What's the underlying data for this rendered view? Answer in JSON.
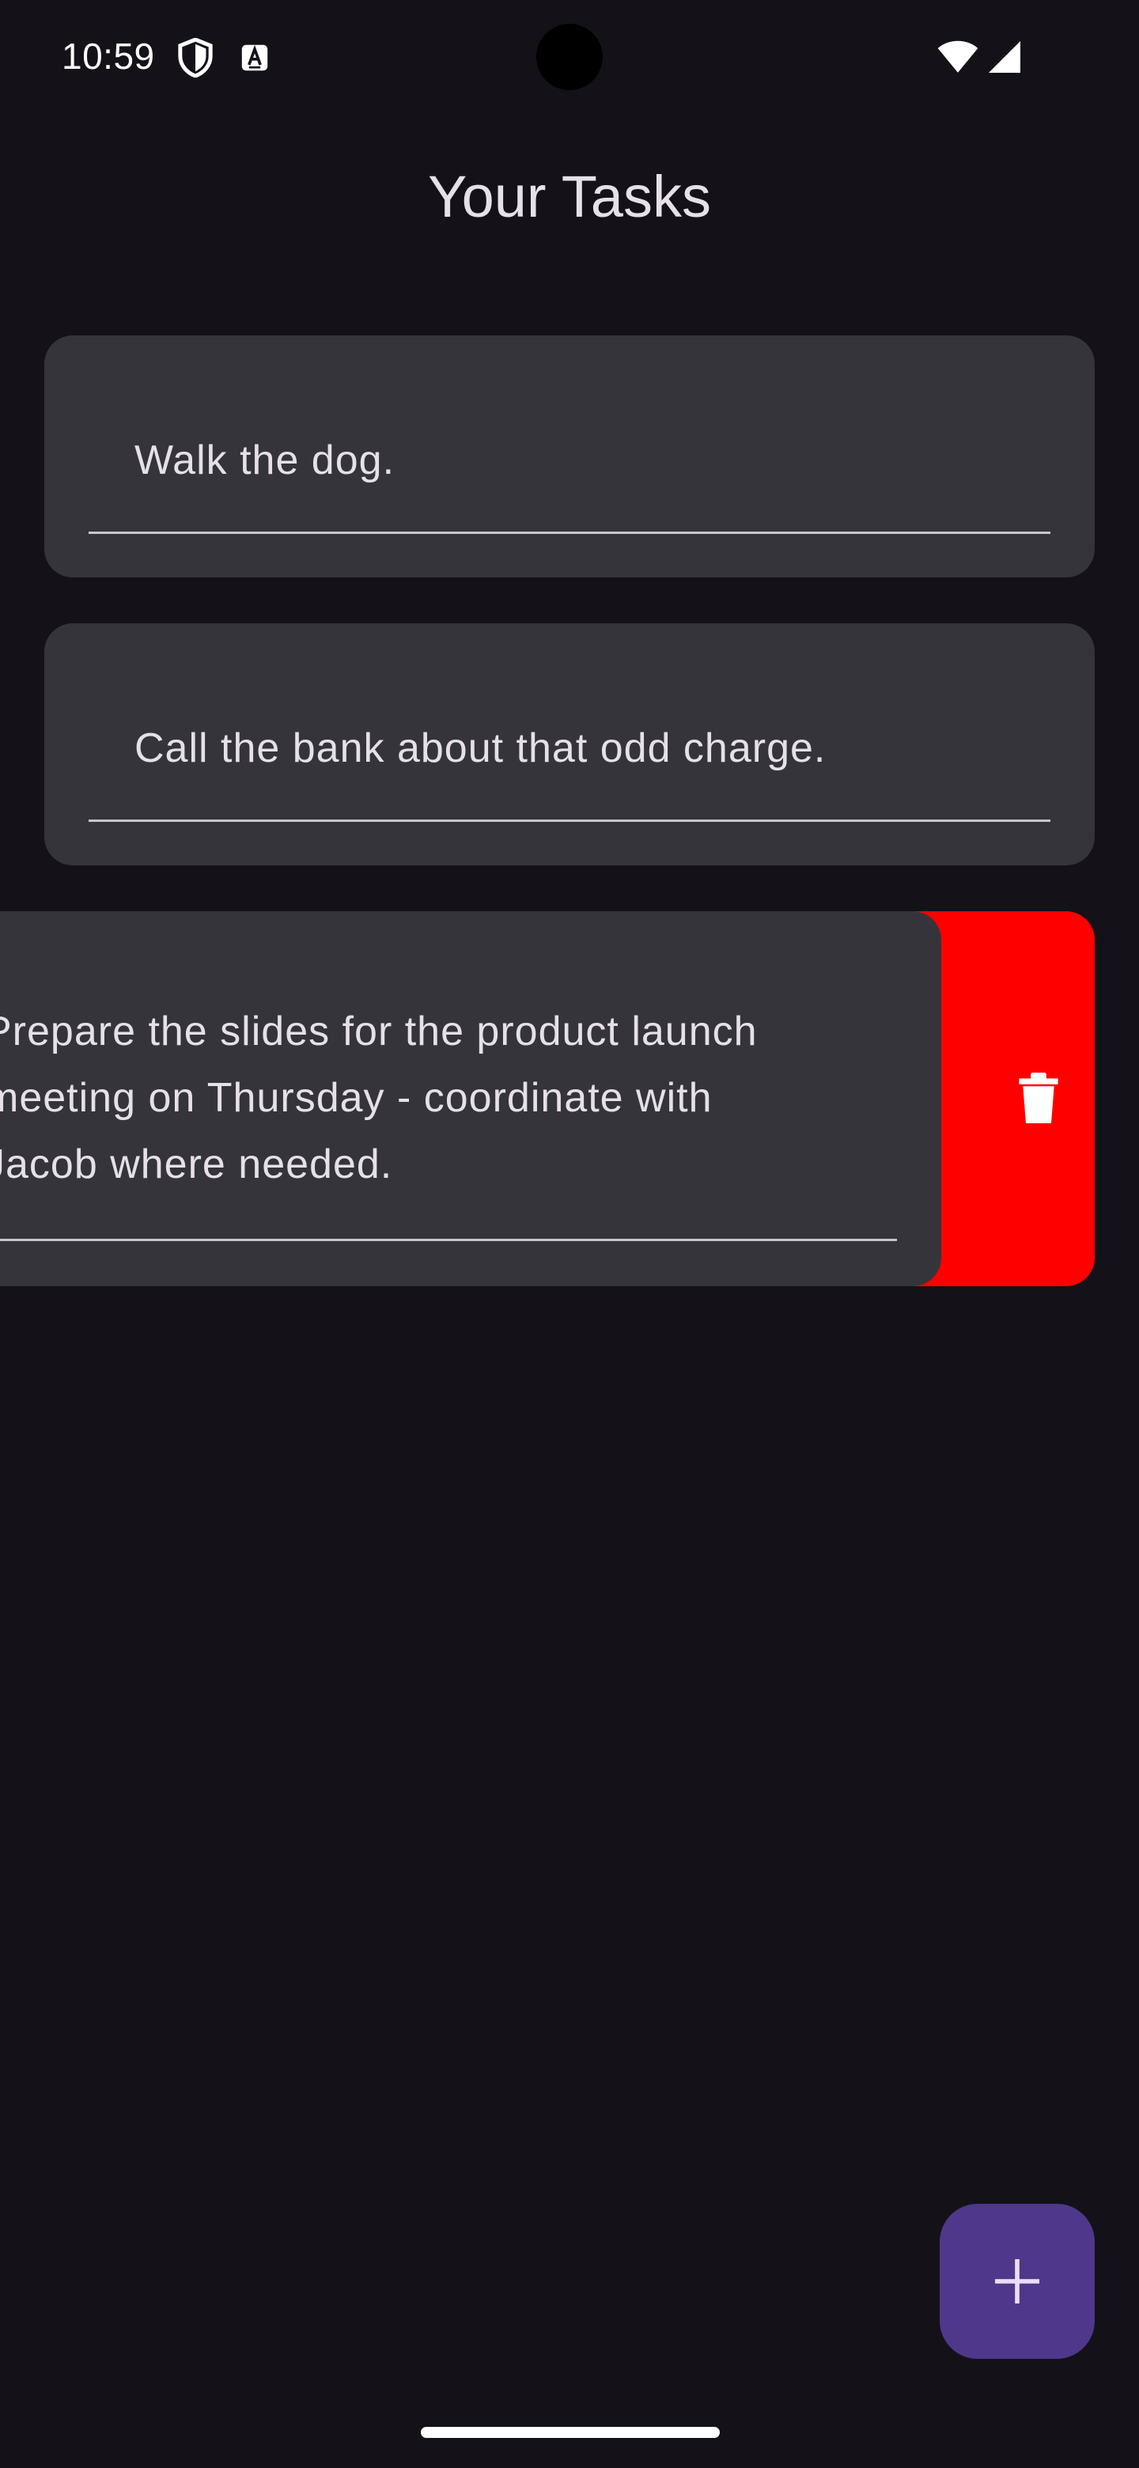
{
  "status_bar": {
    "time": "10:59",
    "icons": [
      "shield-icon",
      "a-badge-icon",
      "wifi-icon",
      "signal-icon"
    ]
  },
  "header": {
    "title": "Your Tasks"
  },
  "tasks": [
    {
      "text": "Walk the dog."
    },
    {
      "text": "Call the bank about that odd charge."
    },
    {
      "text": "Prepare the slides for the product launch\nmeeting on Thursday - coordinate with\nJacob where needed.",
      "state": "swiped-to-delete"
    }
  ],
  "delete_action": {
    "icon": "trash-icon",
    "color": "#ff0000"
  },
  "fab": {
    "icon": "plus-icon",
    "color": "#4f378b"
  },
  "colors": {
    "background": "#141218",
    "card": "#36343b",
    "text": "#e6e0e9"
  }
}
